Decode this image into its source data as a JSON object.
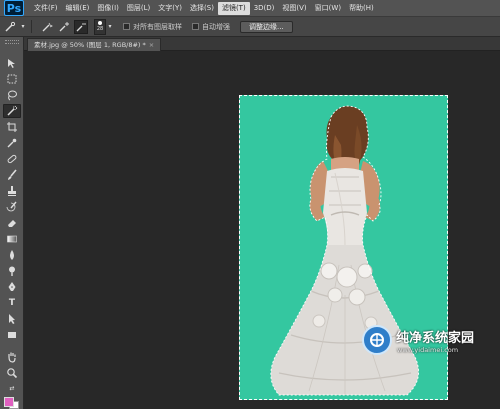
{
  "app": {
    "logo": "Ps"
  },
  "menu": [
    "文件(F)",
    "编辑(E)",
    "图像(I)",
    "图层(L)",
    "文字(Y)",
    "选择(S)",
    "滤镜(T)",
    "3D(D)",
    "视图(V)",
    "窗口(W)",
    "帮助(H)"
  ],
  "menu_active_index": 6,
  "options": {
    "brush_size": "28",
    "sample_all_layers": "对所有图层取样",
    "auto_enhance": "自动增强",
    "refine_edge": "调整边缘..."
  },
  "document": {
    "tab_title": "素材.jpg @ 50% (图层 1, RGB/8#) *",
    "close": "×"
  },
  "colors": {
    "canvas_bg": "#34c7a0",
    "foreground": "#e060c0",
    "background": "#ffffff"
  },
  "tools": [
    "move-tool-icon",
    "marquee-tool-icon",
    "lasso-tool-icon",
    "quick-selection-tool-icon",
    "crop-tool-icon",
    "eyedropper-tool-icon",
    "healing-brush-tool-icon",
    "brush-tool-icon",
    "clone-stamp-tool-icon",
    "history-brush-tool-icon",
    "eraser-tool-icon",
    "gradient-tool-icon",
    "blur-tool-icon",
    "dodge-tool-icon",
    "pen-tool-icon",
    "type-tool-icon",
    "path-selection-tool-icon",
    "rectangle-tool-icon",
    "hand-tool-icon",
    "zoom-tool-icon"
  ],
  "watermark": {
    "title": "纯净系统家园",
    "url": "www.yidaimei.com"
  }
}
